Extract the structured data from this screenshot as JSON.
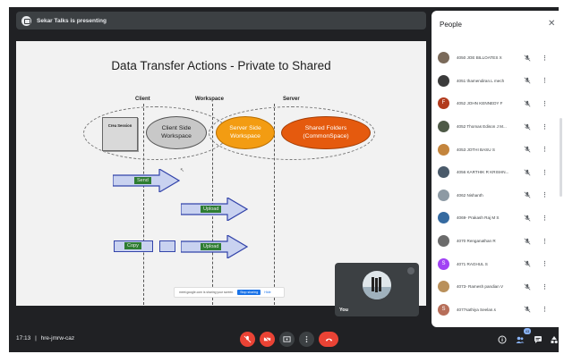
{
  "banner": {
    "text": "Sekar Talks is presenting"
  },
  "slide": {
    "title": "Data Transfer Actions - Private to Shared",
    "columns": [
      "Client",
      "Workspace",
      "Server"
    ],
    "card_label": "Crea Session",
    "ellipses": [
      "Client Side Workspace",
      "Server Side Workspace",
      "Shared Folders (CommonSpace)"
    ],
    "arrow_tags": [
      "Send",
      "Upload",
      "Copy",
      "Upload"
    ],
    "share_bar": {
      "text": "meet.google.com is sharing your screen.",
      "stop_label": "Stop sharing",
      "hide_label": "Hide"
    }
  },
  "self_tile": {
    "label": "You"
  },
  "bottom": {
    "time": "17:13",
    "separator": "|",
    "code": "hre-jmrw-caz",
    "participant_count": "43"
  },
  "people_panel": {
    "title": "People",
    "close_icon": "close-icon",
    "participants": [
      {
        "name": "4050 JOE BILLOATES X",
        "initial": "",
        "color": "#7a6a5a"
      },
      {
        "name": "4051 thamendiran.L mech",
        "initial": "",
        "color": "#3b3b3b"
      },
      {
        "name": "4052 JOHN KENNEDY F",
        "initial": "F",
        "color": "#b23b1d"
      },
      {
        "name": "4052 Thomas Edison J M...",
        "initial": "",
        "color": "#4e5a47"
      },
      {
        "name": "4053 JOTHI BASU S",
        "initial": "",
        "color": "#c4853d"
      },
      {
        "name": "4056 KARTHIK R KRISHN...",
        "initial": "",
        "color": "#4a5a6a"
      },
      {
        "name": "4062 Nishanth",
        "initial": "",
        "color": "#8d9aa4"
      },
      {
        "name": "4069- Prakash Raj M S",
        "initial": "",
        "color": "#356aa0"
      },
      {
        "name": "4070 Renganathan R",
        "initial": "",
        "color": "#6b6b6b"
      },
      {
        "name": "4071 RAGHUL S",
        "initial": "S",
        "color": "#a142f4"
      },
      {
        "name": "4073- Ramesh pandian V",
        "initial": "",
        "color": "#b9905b"
      },
      {
        "name": "4077sathiya Seelan.s",
        "initial": "S",
        "color": "#b76e59"
      }
    ]
  },
  "colors": {
    "accent": "#1a73e8",
    "danger": "#ea4335",
    "bg": "#202124"
  }
}
